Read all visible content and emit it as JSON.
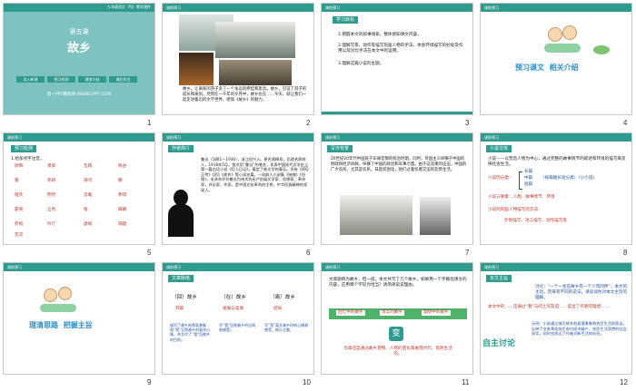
{
  "slide_numbers": [
    "1",
    "2",
    "3",
    "4",
    "5",
    "6",
    "7",
    "8",
    "9",
    "10",
    "11",
    "12"
  ],
  "header_label": "课前预习",
  "s1": {
    "top_note": "九年级语文（RJ）教学课件",
    "lesson": "第五课",
    "title": "故乡",
    "pills": [
      "导入新课",
      "预习检测",
      "课堂小结",
      "课后作业"
    ],
    "footer": "第一PPT模板网-WWW.1PPT.COM"
  },
  "s2": {
    "caption": "故乡，让离家的游子多了一个永远的牵挂和思念。故乡，见证了游子的成长和离别。然而在一千年的岁月中，故乡也在……今天，就让我们一起走进鲁迅的文学世界，感受《故乡》的魅力。"
  },
  "s3": {
    "tag": "学习目标",
    "lines": [
      "1.把握本文的叙事线索，整体感知课文内容。",
      "2.理解写景、动作等描写刻画人物的手法，体会环境描写的妙处及作用以及对比手法在本文中的运用。",
      "3.理解这篇小说的主题。"
    ]
  },
  "s4": {
    "label1": "预习课文",
    "label2": "相关介绍"
  },
  "s5": {
    "tag": "预习检测",
    "heading": "1.给加点字注音。",
    "words": [
      "阴晦",
      "萧索",
      "瓦楞",
      "秕谷",
      "猹",
      "鹁鸪",
      "潮汛",
      "髀",
      "嗤笑",
      "惘然",
      "恣睢",
      "寒噤",
      "鄙夷",
      "五色",
      "嗤",
      "蹒跚",
      "折纸",
      "伶仃",
      "瑟缩",
      "隔膜",
      "荒凉"
    ]
  },
  "s6": {
    "tag": "作者简介",
    "text": "鲁迅（1881—1936），浙江绍兴人。原名周樟寿，后改名周树人，1918年5月，首次用“鲁迅”的笔名，发表中国现代文学史上第一篇白话小说《狂人日记》，奠定了新文学的基石。另有《阿Q正传》《药》《故乡》等小说名篇，一同收入小说集《呐喊》《彷徨》，毛泽东评价鲁迅为伟大的无产阶级文学家、思想家、革命家，评论家，作家，是中国文化革命的主将，中华民族精神的发现人。"
  },
  "s7": {
    "tag": "写作背景",
    "text": "20世纪20年代中国处于军阀官僚的统治时期，同时，帝国主义纵横于中国的财政和经济命脉，纵横了中国的政治和军事力量。由于这双重的压迫，中国的广大农民，尤其是农民，日趋贫困化，他们过着饥寒交迫的悲惨生活。"
  },
  "s8": {
    "tag": "小说文体",
    "intro": "小说——以塑造人物为中心，通过完整的故事情节的叙述和环境的描写来反映社会生活。",
    "k1": "小说的分类：",
    "types": [
      "长篇",
      "中篇",
      "短篇"
    ],
    "types_note": "（按篇幅长短分类）（小小说）",
    "k2": "小说三要素：人物、故事情节、环境",
    "k3": "小说的刻画人物描写的方法：",
    "k4": "外貌描写、语言描写、动作描写等"
  },
  "s9": {
    "label1": "理清思路",
    "label2": "把握主旨"
  },
  "s10": {
    "tag": "文章脉络",
    "top": [
      "（回）故乡",
      "（在）故乡",
      "（离）故乡"
    ],
    "mid": [
      "开篇",
      "发展与高潮",
      "结局"
    ],
    "notes": [
      "描写了故乡的萧条景象和“我”见到故乡的复杂心情，并交代了“我”回故乡的目的。",
      "写“我”回到故乡的见闻和感受。",
      "写“我”离开故乡时的心情和感受，揭示主题。"
    ]
  },
  "s11": {
    "intro": "文章题目为故乡，但一提，本文共写了几个故乡。如果用一个字概括课文的内容，应用哪个字较为恰当？请简单说说理由。",
    "boxes": [
      "回忆中的故乡",
      "现实的故乡",
      "理想中的故乡"
    ],
    "center": "变",
    "note": "文章还是通过故乡景物、人物的变化来展现时代、农民生活的。"
  },
  "s12": {
    "tag": "本文主旨",
    "p1": "讨论：“一个一生在故乡有一个少年同伴”，本文的主旨，历来有不同的说法，请谈谈你对本文主旨的理解。",
    "p2": "本文中的……还通过“我”与闰土的友谊……提出了作者的理想……",
    "p3": "示例：小说通过描写故乡的衰落景象和农民生活的悲苦，反映了辛亥革命前后农村经济破产，农民生活悲惨的社会现实，同时也表达了作者对新生活的向往。",
    "side": "自主讨论"
  }
}
